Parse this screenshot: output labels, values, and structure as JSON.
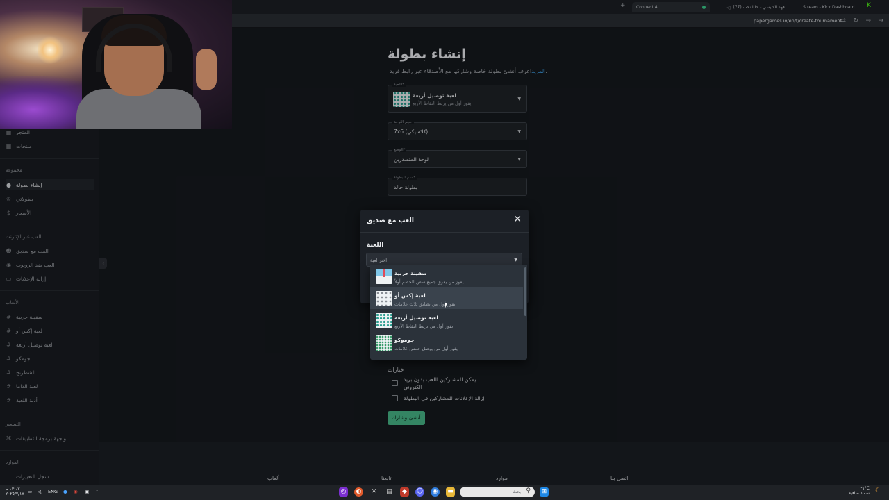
{
  "browser": {
    "tabs": [
      {
        "label": "Connect 4",
        "active": true
      },
      {
        "label": "(77) فهد الكبيسي - خلنا نحب",
        "active": false
      },
      {
        "label": "Stream - Kick Dashboard",
        "active": false
      }
    ],
    "url": "papergames.io/en/t/create-tournament"
  },
  "sidebar": {
    "top_items": [
      {
        "label": "المتجر",
        "icon": "store-icon"
      },
      {
        "label": "منتجات",
        "icon": "grid-icon"
      }
    ],
    "sections": [
      {
        "title": "مجموعة",
        "items": [
          {
            "label": "إنشاء بطولة",
            "icon": "plus-circle-icon",
            "active": true
          },
          {
            "label": "بطولاتي",
            "icon": "trophy-icon"
          },
          {
            "label": "الأسعار",
            "icon": "dollar-icon"
          }
        ]
      },
      {
        "title": "العب عبر الإنترنت",
        "items": [
          {
            "label": "العب مع صديق",
            "icon": "users-icon"
          },
          {
            "label": "العب ضد الروبوت",
            "icon": "robot-icon"
          },
          {
            "label": "إزالة الإعلانات",
            "icon": "ad-block-icon"
          }
        ]
      },
      {
        "title": "الألعاب",
        "items": [
          {
            "label": "سفينة حربية",
            "icon": "hash-icon"
          },
          {
            "label": "لعبة إكس أو",
            "icon": "hash-icon"
          },
          {
            "label": "لعبة توصيل أربعة",
            "icon": "hash-icon"
          },
          {
            "label": "جومكو",
            "icon": "hash-icon"
          },
          {
            "label": "الشطرنج",
            "icon": "hash-icon"
          },
          {
            "label": "لعبة الداما",
            "icon": "hash-icon"
          },
          {
            "label": "أدلة اللعبة",
            "icon": "hash-icon"
          }
        ]
      },
      {
        "title": "التسعير",
        "items": [
          {
            "label": "واجهة برمجة التطبيقات",
            "icon": "api-icon"
          }
        ]
      },
      {
        "title": "الموارد",
        "items": [
          {
            "label": "سجل التغييرات",
            "icon": "changelog-icon"
          }
        ]
      }
    ]
  },
  "page": {
    "title": "إنشاء بطولة",
    "subtitle_prefix": "اعرف أنشئ بطولة خاصة وشاركها مع الأصدقاء عبر رابط فريد.",
    "subtitle_link": "المزيد",
    "fields": {
      "game": {
        "label": "اللعبة*",
        "name": "لعبة توصيل أربعة",
        "desc": "يفوز أول من يربط النقاط الأربع"
      },
      "board": {
        "label": "حجم اللوحة",
        "value": "7x6 (كلاسيكي)"
      },
      "mode": {
        "label": "الوضع*",
        "value": "لوحة المتصدرين"
      },
      "name": {
        "label": "اسم البطولة*",
        "value": "بطولة خالد"
      }
    },
    "options_title": "خيارات",
    "options": [
      {
        "label": "يمكن للمشاركين اللعب بدون بريد الكتروني",
        "checked": false
      },
      {
        "label": "إزالة الإعلانات للمشاركين في البطولة",
        "checked": false
      }
    ],
    "create_button": "أنشئ وشارك"
  },
  "modal": {
    "title": "العب مع صديق",
    "game_label": "اللعبة",
    "select_placeholder": "اختر لعبة",
    "options": [
      {
        "name": "سفينة حربية",
        "desc": "يفوز من يغرق جميع سفن الخصم أولاً",
        "thumb": "ship"
      },
      {
        "name": "لعبة إكس أو",
        "desc": "يفوز أول من يطابق ثلاث علامات",
        "thumb": "xo",
        "hover": true
      },
      {
        "name": "لعبة توصيل أربعة",
        "desc": "يفوز أول من يربط النقاط الأربع",
        "thumb": "grid"
      },
      {
        "name": "جوموكو",
        "desc": "يفوز أول من يوصل خمس علامات",
        "thumb": "gomoku"
      }
    ]
  },
  "footer": {
    "columns": [
      "ألعاب",
      "تابعنا",
      "موارد",
      "اتصل بنا"
    ]
  },
  "taskbar": {
    "search_placeholder": "بحث",
    "language": "ENG",
    "time": "٠٣:٠٧ م",
    "date": "٢٠٢٥/٧/١٧",
    "weather_temp": "٣١°C",
    "weather_desc": "سماء صافية"
  }
}
